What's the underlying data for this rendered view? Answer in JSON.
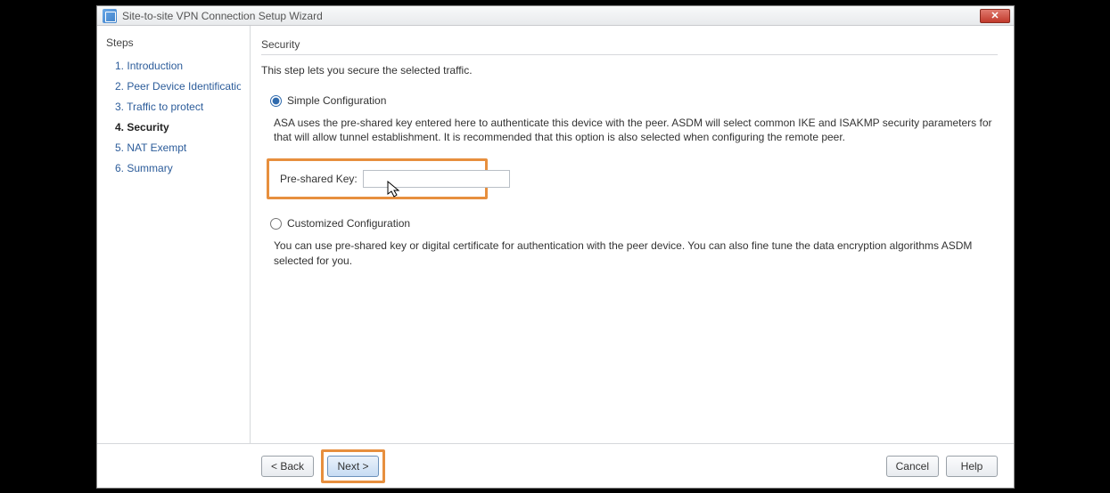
{
  "window": {
    "title": "Site-to-site VPN Connection Setup Wizard"
  },
  "sidebar": {
    "header": "Steps",
    "items": [
      {
        "num": "1.",
        "label": "Introduction"
      },
      {
        "num": "2.",
        "label": "Peer Device Identificatio"
      },
      {
        "num": "3.",
        "label": "Traffic to protect"
      },
      {
        "num": "4.",
        "label": "Security"
      },
      {
        "num": "5.",
        "label": "NAT Exempt"
      },
      {
        "num": "6.",
        "label": "Summary"
      }
    ],
    "current_index": 3
  },
  "main": {
    "title": "Security",
    "subtitle": "This step lets you secure the selected traffic.",
    "options": {
      "simple": {
        "label": "Simple Configuration",
        "selected": true,
        "description": "ASA uses the pre-shared key entered here to authenticate this device with the peer. ASDM will select common IKE and ISAKMP security parameters for that will allow tunnel establishment. It is recommended that this option is also selected when configuring the remote peer.",
        "psk_label": "Pre-shared Key:",
        "psk_value": ""
      },
      "custom": {
        "label": "Customized Configuration",
        "selected": false,
        "description": "You can use pre-shared key or digital certificate for authentication with the peer device. You can also fine tune the data encryption algorithms ASDM selected for you."
      }
    }
  },
  "buttons": {
    "back": "< Back",
    "next": "Next >",
    "cancel": "Cancel",
    "help": "Help"
  }
}
